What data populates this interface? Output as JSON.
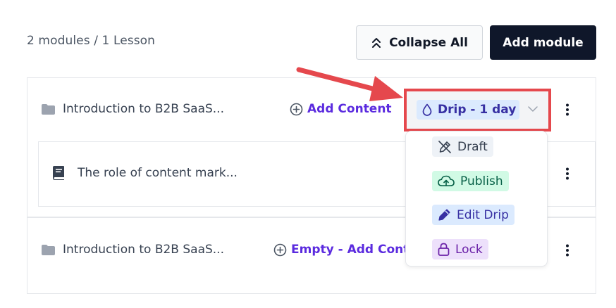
{
  "summary": "2 modules / 1 Lesson",
  "toolbar": {
    "collapse_label": "Collapse All",
    "add_module_label": "Add module"
  },
  "modules": [
    {
      "title": "Introduction to B2B SaaS...",
      "add_label": "Add Content",
      "drip_label": "Drip - 1 day",
      "lessons": [
        {
          "title": "The role of content mark..."
        }
      ]
    },
    {
      "title": "Introduction to B2B SaaS...",
      "add_label": "Empty - Add Conte"
    }
  ],
  "drip_menu": {
    "options": [
      {
        "label": "Draft",
        "icon": "pencil-off-icon"
      },
      {
        "label": "Publish",
        "icon": "cloud-upload-icon"
      },
      {
        "label": "Edit Drip",
        "icon": "pencil-icon"
      },
      {
        "label": "Lock",
        "icon": "lock-icon"
      }
    ]
  },
  "colors": {
    "accent": "#5b2bdf",
    "primary_button": "#0f172a",
    "highlight": "#e5484d"
  }
}
